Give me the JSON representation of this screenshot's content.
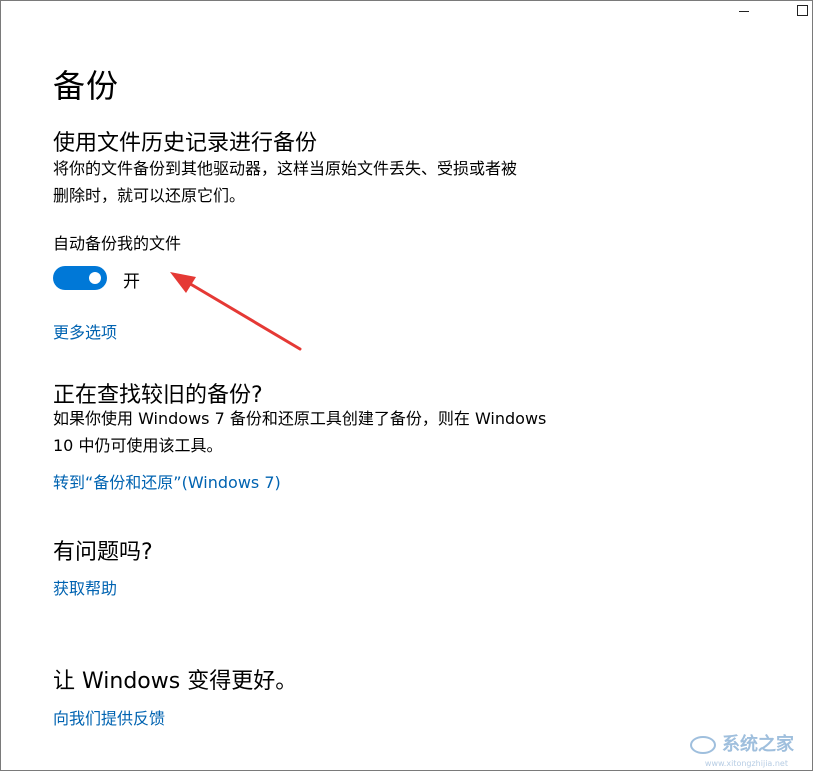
{
  "page": {
    "title": "备份"
  },
  "file_history": {
    "heading": "使用文件历史记录进行备份",
    "description_line1": "将你的文件备份到其他驱动器，这样当原始文件丢失、受损或者被",
    "description_line2": "删除时，就可以还原它们。",
    "toggle_label": "自动备份我的文件",
    "toggle_state": "开",
    "toggle_on": true,
    "more_options": "更多选项"
  },
  "older_backup": {
    "heading": "正在查找较旧的备份?",
    "description_line1": "如果你使用 Windows 7 备份和还原工具创建了备份，则在 Windows",
    "description_line2": "10 中仍可使用该工具。",
    "link": "转到“备份和还原”(Windows 7)"
  },
  "help": {
    "heading": "有问题吗?",
    "link": "获取帮助"
  },
  "feedback": {
    "heading": "让 Windows 变得更好。",
    "link": "向我们提供反馈"
  },
  "watermark": {
    "text": "系统之家",
    "url": "www.xitongzhijia.net"
  },
  "colors": {
    "accent": "#0078d7",
    "link": "#0063b1",
    "annotation_arrow": "#e53935"
  },
  "icons": {
    "minimize": "minimize-icon",
    "maximize": "maximize-icon"
  }
}
